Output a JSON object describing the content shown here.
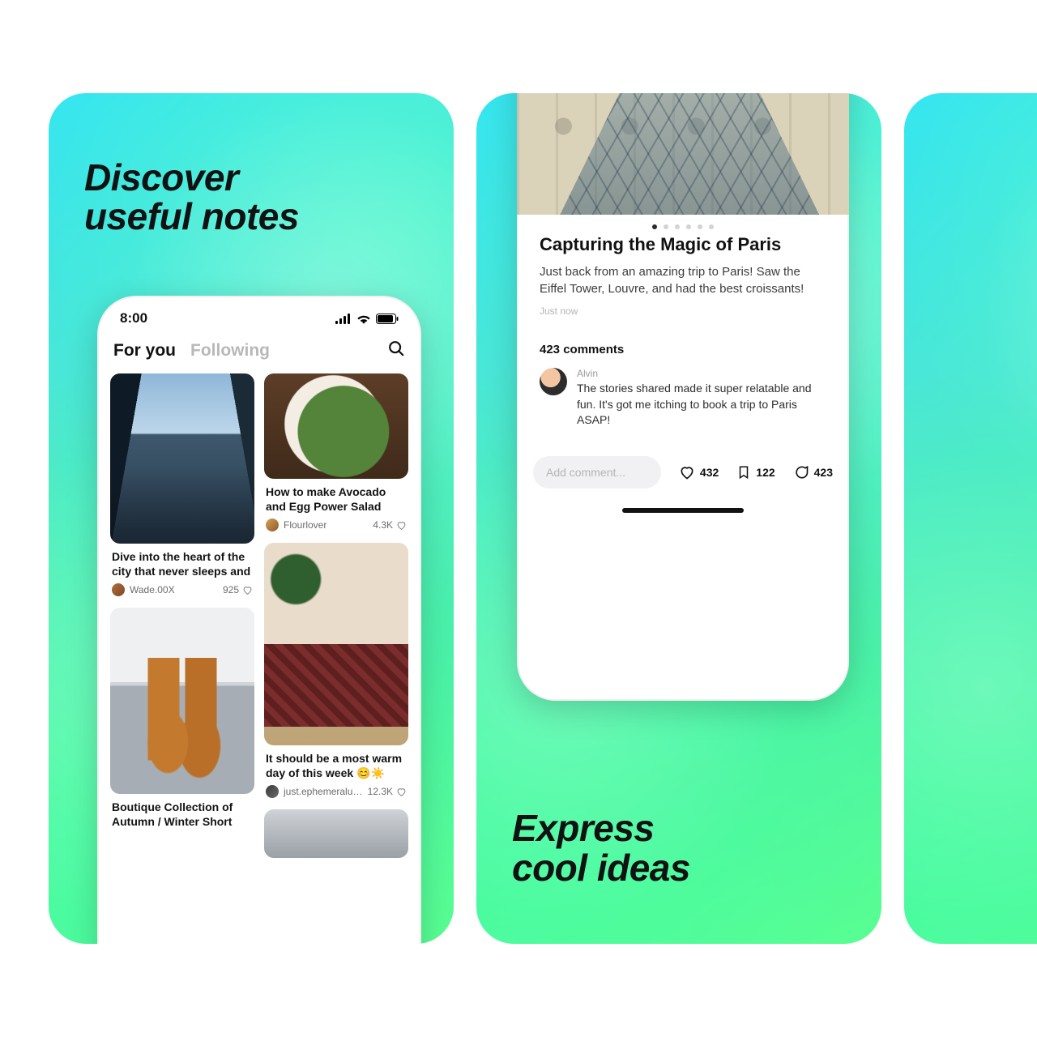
{
  "slide1": {
    "headline_l1": "Discover",
    "headline_l2": "useful notes",
    "statusbar": {
      "time": "8:00"
    },
    "tabs": {
      "active": "For you",
      "inactive": "Following"
    },
    "feed": [
      {
        "title": "Dive into the heart of the city that never sleeps and",
        "author": "Wade.00X",
        "likes": "925"
      },
      {
        "title": "How to make Avocado and Egg Power Salad",
        "author": "Flourlover",
        "likes": "4.3K"
      },
      {
        "title": "Boutique Collection of Autumn / Winter Short",
        "author": "",
        "likes": ""
      },
      {
        "title": "It should be a most warm day of this week 😊☀️",
        "author": "just.ephemeralu…",
        "likes": "12.3K"
      }
    ]
  },
  "slide2": {
    "post": {
      "title": "Capturing the Magic of Paris",
      "body": "Just back from an amazing trip to Paris! Saw the Eiffel Tower, Louvre, and had the best croissants!",
      "timestamp": "Just now",
      "comments_header": "423 comments",
      "comment": {
        "name": "Alvin",
        "text": "The stories shared made it super relatable and fun. It's got me itching to book a trip to Paris ASAP!"
      },
      "add_comment_placeholder": "Add comment...",
      "stats": {
        "likes": "432",
        "bookmarks": "122",
        "comments": "423"
      }
    },
    "headline_l1": "Express",
    "headline_l2": "cool ideas"
  }
}
